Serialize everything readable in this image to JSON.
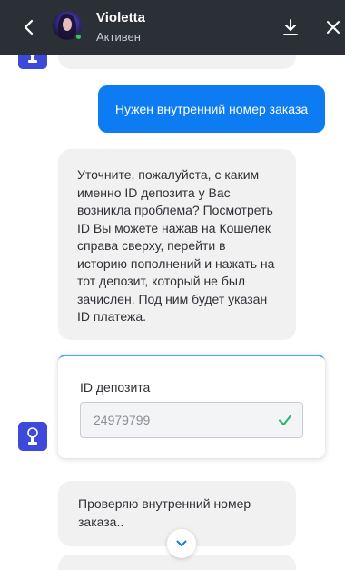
{
  "header": {
    "contact_name": "Violetta",
    "contact_status": "Активен",
    "background_color": "#2b2f36",
    "online_dot_color": "#3cc45b",
    "icons": [
      "back-arrow-icon",
      "download-icon",
      "close-icon"
    ]
  },
  "messages": [
    {
      "id": "m0",
      "from": "agent",
      "text": ""
    },
    {
      "id": "m1",
      "from": "user",
      "text": "Нужен внутренний номер заказа"
    },
    {
      "id": "m2",
      "from": "agent",
      "text": "Уточните, пожалуйста, с каким именно ID депозита у Вас возникла проблема? Посмотреть ID Вы можете нажав на Кошелек справа сверху, перейти в историю пополнений и нажать на тот депозит, который не был зачислен. Под ним будет указан ID платежа."
    },
    {
      "id": "m3",
      "from": "agent",
      "text": "Проверяю внутренний номер заказа.."
    }
  ],
  "form": {
    "field_label": "ID депозита",
    "field_value": "24979799",
    "validated": true,
    "check_color": "#2bb673"
  },
  "colors": {
    "user_bubble": "#0d7cf2",
    "agent_bubble": "#f1f1f2",
    "bot_badge": "#3d49d8"
  }
}
